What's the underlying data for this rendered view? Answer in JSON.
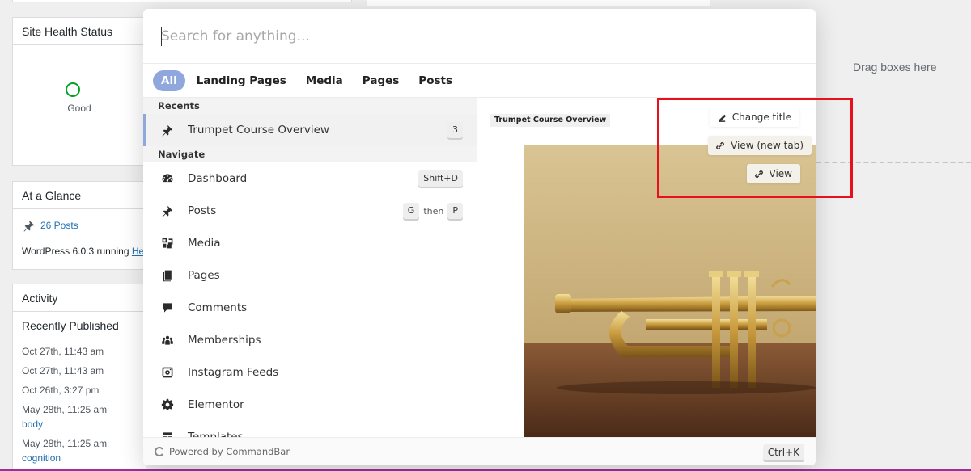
{
  "dashboard": {
    "site_health": {
      "title": "Site Health Status",
      "status": "Good"
    },
    "at_a_glance": {
      "title": "At a Glance",
      "posts_count": "26 Posts",
      "wp_version_text": "WordPress 6.0.3 running ",
      "theme_link": "He"
    },
    "activity": {
      "title": "Activity",
      "subtitle": "Recently Published",
      "items": [
        {
          "date": "Oct 27th, 11:43 am",
          "link": ""
        },
        {
          "date": "Oct 27th, 11:43 am",
          "link": ""
        },
        {
          "date": "Oct 26th, 3:27 pm",
          "link": ""
        },
        {
          "date": "May 28th, 11:25 am",
          "link": "body"
        },
        {
          "date": "May 28th, 11:25 am",
          "link": "cognition"
        }
      ]
    },
    "drag_boxes": "Drag boxes here"
  },
  "commandbar": {
    "search": {
      "placeholder": "Search for anything...",
      "value": ""
    },
    "tabs": [
      "All",
      "Landing Pages",
      "Media",
      "Pages",
      "Posts"
    ],
    "active_tab": "All",
    "recents": {
      "header": "Recents",
      "items": [
        {
          "label": "Trumpet Course Overview",
          "icon": "pin-icon",
          "badge": "3",
          "selected": true
        }
      ]
    },
    "navigate": {
      "header": "Navigate",
      "items": [
        {
          "label": "Dashboard",
          "icon": "dashboard-icon",
          "shortcut": [
            "Shift+D"
          ]
        },
        {
          "label": "Posts",
          "icon": "pin-icon",
          "shortcut": [
            "G",
            "then",
            "P"
          ]
        },
        {
          "label": "Media",
          "icon": "media-icon"
        },
        {
          "label": "Pages",
          "icon": "pages-icon"
        },
        {
          "label": "Comments",
          "icon": "comment-icon"
        },
        {
          "label": "Memberships",
          "icon": "groups-icon"
        },
        {
          "label": "Instagram Feeds",
          "icon": "instagram-icon"
        },
        {
          "label": "Elementor",
          "icon": "gear-icon"
        },
        {
          "label": "Templates",
          "icon": "templates-icon"
        }
      ]
    },
    "preview": {
      "title": "Trumpet Course Overview",
      "actions": [
        "Change title",
        "View (new tab)",
        "View"
      ]
    },
    "footer": {
      "powered_by": "Powered by CommandBar",
      "shortcut": "Ctrl+K"
    }
  },
  "colors": {
    "accent": "#8fa7dc",
    "highlight": "#e8111b",
    "wp_link": "#2271b1",
    "health_good": "#00a32a"
  }
}
